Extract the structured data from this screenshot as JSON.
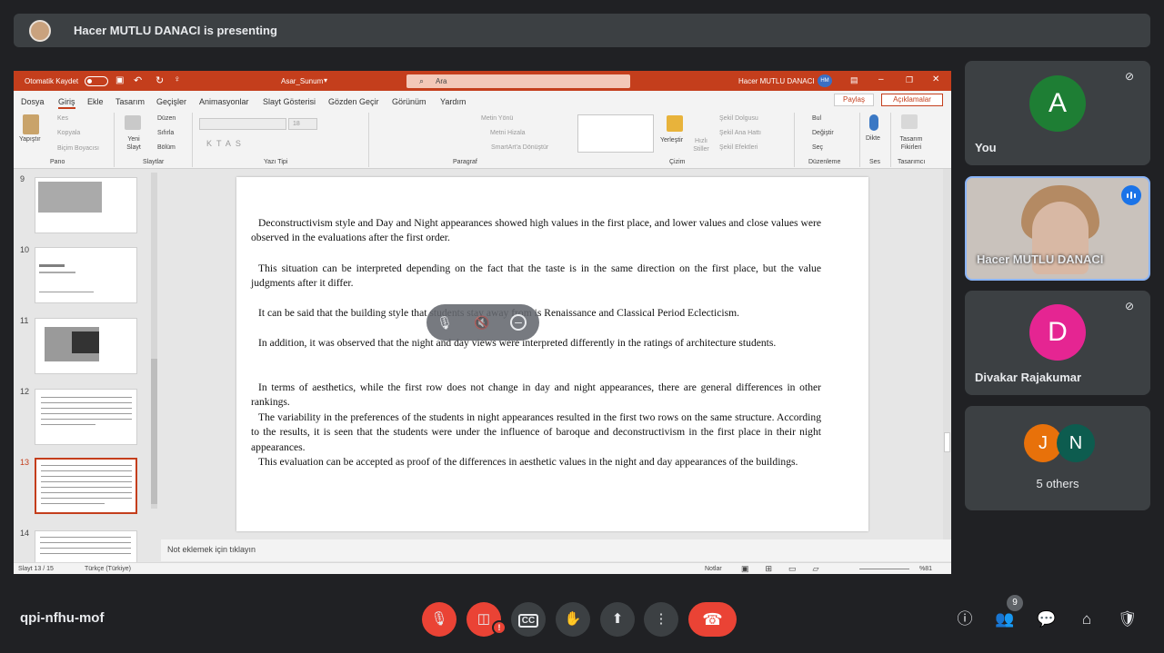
{
  "banner": {
    "text": "Hacer MUTLU DANACI is presenting"
  },
  "ppt": {
    "autosave": "Otomatik Kaydet",
    "filename": "Asar_Sunum",
    "search": "Ara",
    "user": "Hacer MUTLU DANACI",
    "user_initials": "HM",
    "menus": [
      "Dosya",
      "Giriş",
      "Ekle",
      "Tasarım",
      "Geçişler",
      "Animasyonlar",
      "Slayt Gösterisi",
      "Gözden Geçir",
      "Görünüm",
      "Yardım"
    ],
    "share": "Paylaş",
    "comments": "Açıklamalar",
    "ribbon": {
      "paste": "Yapıştır",
      "cut": "Kes",
      "copy": "Kopyala",
      "format_painter": "Biçim Boyacısı",
      "new_slide": "Yeni Slayt",
      "layout": "Düzen",
      "reset": "Sıfırla",
      "section": "Bölüm",
      "font_size": "18",
      "text_direction": "Metin Yönü",
      "align_text": "Metni Hizala",
      "smartart": "SmartArt'a Dönüştür",
      "arrange": "Yerleştir",
      "quick_styles": "Hızlı Stiller",
      "shape_fill": "Şekil Dolgusu",
      "shape_outline": "Şekil Ana Hattı",
      "shape_effects": "Şekil Efektleri",
      "find": "Bul",
      "replace": "Değiştir",
      "select": "Seç",
      "dictate": "Dikte",
      "designer": "Tasarım Fikirleri",
      "groups": [
        "Pano",
        "Slaytlar",
        "Yazı Tipi",
        "Paragraf",
        "Çizim",
        "Düzenleme",
        "Ses",
        "Tasarımcı"
      ]
    },
    "slide_numbers": [
      "9",
      "10",
      "11",
      "12",
      "13",
      "14"
    ],
    "slide_paragraphs": [
      "Deconstructivism style and Day and Night appearances showed high values in the first place, and lower values and close values were observed in the evaluations after the first order.",
      "This situation can be interpreted depending on the fact that the taste is in the same direction on the first place, but the value judgments after it differ.",
      "It can be said that the building style that students stay away from is Renaissance and Classical Period Eclecticism.",
      "In addition, it was observed that the night and day views were interpreted differently in the ratings of architecture students.",
      "In terms of aesthetics, while the first row does not change in day and night appearances, there are general differences in other rankings.",
      "The variability in the preferences of the students in night appearances resulted in the first two rows on the same structure. According to the results, it is seen that the students were under the influence of baroque and deconstructivism in the first place in their night appearances.",
      "This evaluation can be accepted as proof of the differences in aesthetic values in the night and day appearances of the buildings."
    ],
    "notes_placeholder": "Not eklemek için tıklayın",
    "status": {
      "slide": "Slayt 13 / 15",
      "language": "Türkçe (Türkiye)",
      "notes": "Notlar",
      "zoom": "%81"
    }
  },
  "participants": {
    "you": {
      "initial": "A",
      "name": "You",
      "color": "#1e7e34"
    },
    "presenter": {
      "name": "Hacer MUTLU DANACI"
    },
    "divakar": {
      "initial": "D",
      "name": "Divakar Rajakumar",
      "color": "#e52592"
    },
    "others": {
      "initials": [
        "J",
        "N"
      ],
      "colors": [
        "#e8710a",
        "#0d5c4f"
      ],
      "label": "5 others"
    }
  },
  "bottom": {
    "meeting_code": "qpi-nfhu-mof",
    "participant_count": "9"
  }
}
